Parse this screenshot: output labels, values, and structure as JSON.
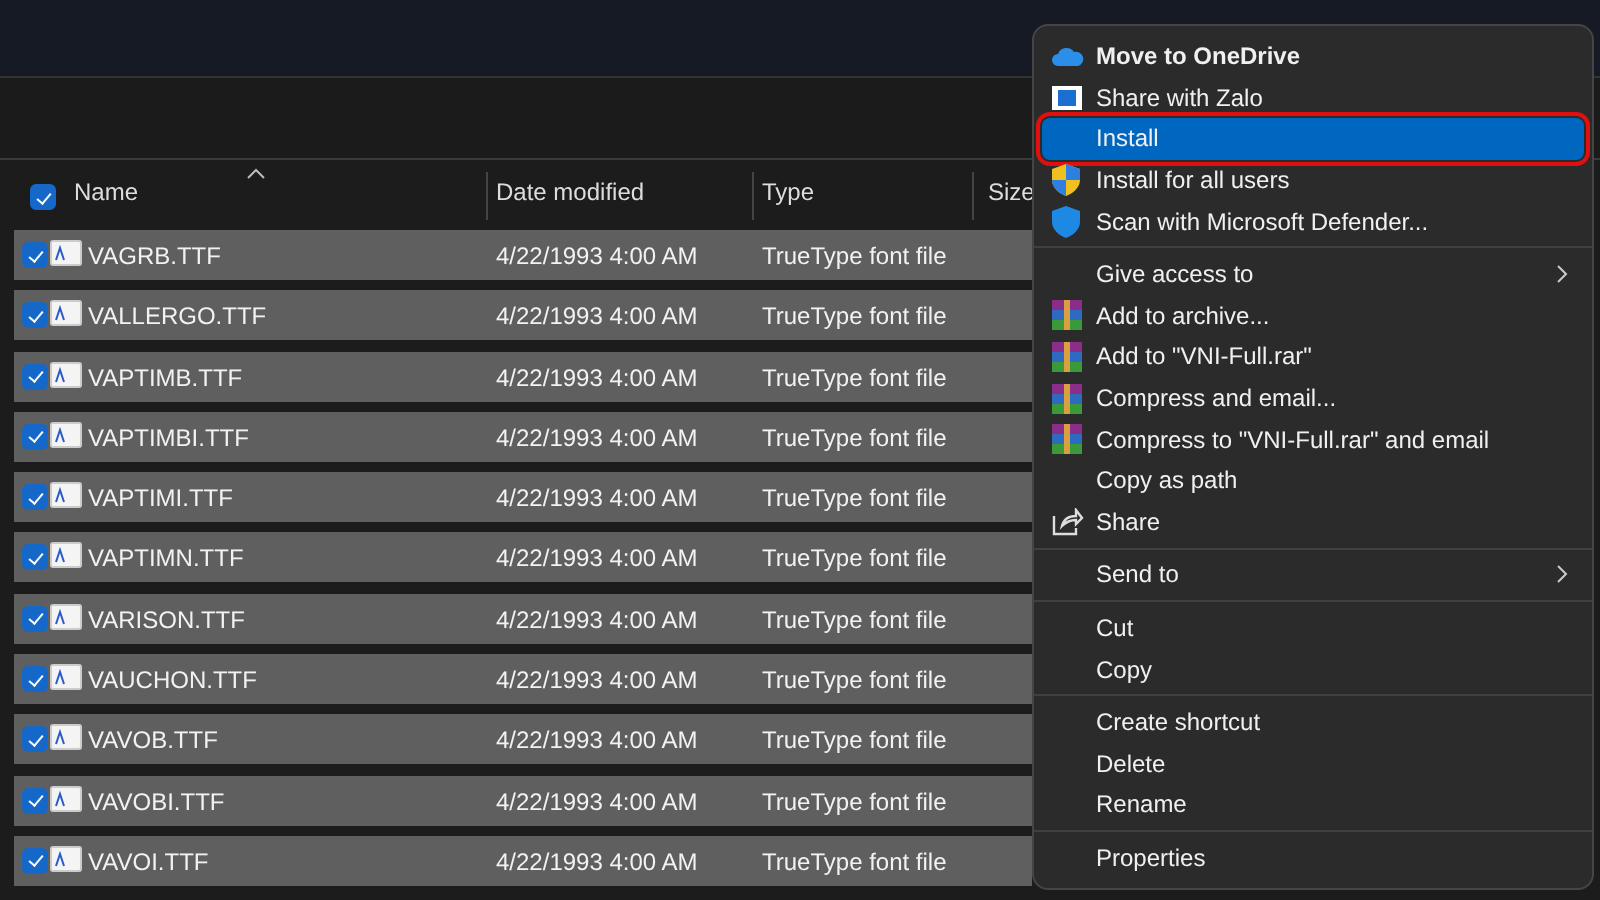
{
  "file_list": {
    "header": {
      "checked": true,
      "columns": [
        "Name",
        "Date modified",
        "Type",
        "Size"
      ]
    },
    "rows": [
      {
        "name": "VAGRB.TTF",
        "date": "4/22/1993 4:00 AM",
        "type": "TrueType font file",
        "checked": true
      },
      {
        "name": "VALLERGO.TTF",
        "date": "4/22/1993 4:00 AM",
        "type": "TrueType font file",
        "checked": true
      },
      {
        "name": "VAPTIMB.TTF",
        "date": "4/22/1993 4:00 AM",
        "type": "TrueType font file",
        "checked": true
      },
      {
        "name": "VAPTIMBI.TTF",
        "date": "4/22/1993 4:00 AM",
        "type": "TrueType font file",
        "checked": true
      },
      {
        "name": "VAPTIMI.TTF",
        "date": "4/22/1993 4:00 AM",
        "type": "TrueType font file",
        "checked": true
      },
      {
        "name": "VAPTIMN.TTF",
        "date": "4/22/1993 4:00 AM",
        "type": "TrueType font file",
        "checked": true
      },
      {
        "name": "VARISON.TTF",
        "date": "4/22/1993 4:00 AM",
        "type": "TrueType font file",
        "checked": true
      },
      {
        "name": "VAUCHON.TTF",
        "date": "4/22/1993 4:00 AM",
        "type": "TrueType font file",
        "checked": true
      },
      {
        "name": "VAVOB.TTF",
        "date": "4/22/1993 4:00 AM",
        "type": "TrueType font file",
        "checked": true
      },
      {
        "name": "VAVOBI.TTF",
        "date": "4/22/1993 4:00 AM",
        "type": "TrueType font file",
        "checked": true
      },
      {
        "name": "VAVOI.TTF",
        "date": "4/22/1993 4:00 AM",
        "type": "TrueType font file",
        "checked": true
      }
    ]
  },
  "context_menu": {
    "groups": [
      [
        {
          "label": "Move to OneDrive",
          "kind": "onedrive",
          "selected": false,
          "bold": true
        },
        {
          "label": "Share with Zalo",
          "kind": "zalo",
          "selected": false
        },
        {
          "label": "Install",
          "kind": "plain",
          "selected": true,
          "outlined": true
        },
        {
          "label": "Install for all users",
          "kind": "shield",
          "selected": false
        },
        {
          "label": "Scan with Microsoft Defender...",
          "kind": "defender",
          "selected": false
        }
      ],
      [
        {
          "label": "Give access to",
          "kind": "plain",
          "selected": false,
          "submenu": true
        },
        {
          "label": "Add to archive...",
          "kind": "archive",
          "selected": false
        },
        {
          "label": "Add to \"VNI-Full.rar\"",
          "kind": "archive",
          "selected": false
        },
        {
          "label": "Compress and email...",
          "kind": "archive",
          "selected": false
        },
        {
          "label": "Compress to \"VNI-Full.rar\" and email",
          "kind": "archive",
          "selected": false
        },
        {
          "label": "Copy as path",
          "kind": "plain",
          "selected": false
        },
        {
          "label": "Share",
          "kind": "share",
          "selected": false
        }
      ],
      [
        {
          "label": "Send to",
          "kind": "plain",
          "selected": false,
          "submenu": true
        }
      ],
      [
        {
          "label": "Cut",
          "kind": "plain",
          "selected": false
        },
        {
          "label": "Copy",
          "kind": "plain",
          "selected": false
        }
      ],
      [
        {
          "label": "Create shortcut",
          "kind": "plain",
          "selected": false
        },
        {
          "label": "Delete",
          "kind": "plain",
          "selected": false
        },
        {
          "label": "Rename",
          "kind": "plain",
          "selected": false
        }
      ],
      [
        {
          "label": "Properties",
          "kind": "plain",
          "selected": false
        }
      ]
    ]
  }
}
